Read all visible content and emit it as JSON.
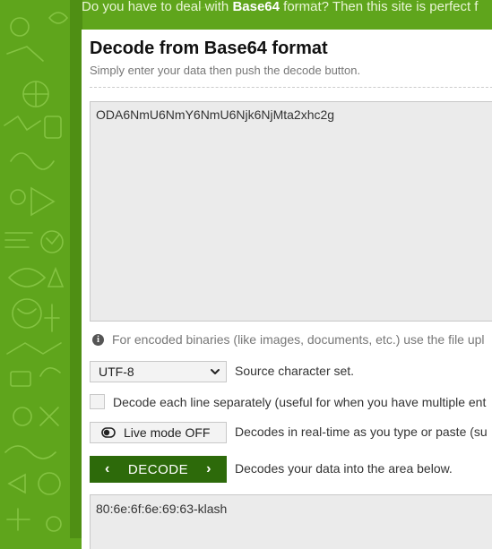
{
  "header": {
    "tagline_before": "Do you have to deal with ",
    "tagline_bold": "Base64",
    "tagline_after": " format? Then this site is perfect f"
  },
  "decoder": {
    "title": "Decode from Base64 format",
    "subtitle": "Simply enter your data then push the decode button.",
    "input_value": "ODA6NmU6NmY6NmU6Njk6NjMta2xhc2g",
    "info_text": "For encoded binaries (like images, documents, etc.) use the file upl",
    "charset": {
      "selected": "UTF-8",
      "label": "Source character set."
    },
    "each_line": {
      "label": "Decode each line separately (useful for when you have multiple ent",
      "checked": false
    },
    "live_mode": {
      "button_label": "Live mode OFF",
      "description": "Decodes in real-time as you type or paste (su"
    },
    "decode_button": {
      "label": "DECODE",
      "description": "Decodes your data into the area below."
    },
    "output_value": "80:6e:6f:6e:69:63-klash"
  },
  "colors": {
    "background_green": "#5fa51c",
    "button_dark_green": "#2d6a0a",
    "panel": "#ffffff",
    "textarea_bg": "#ebebeb"
  },
  "icons": [
    "info-icon",
    "chevron-down-icon",
    "toggle-icon",
    "chevron-left-icon",
    "chevron-right-icon"
  ]
}
